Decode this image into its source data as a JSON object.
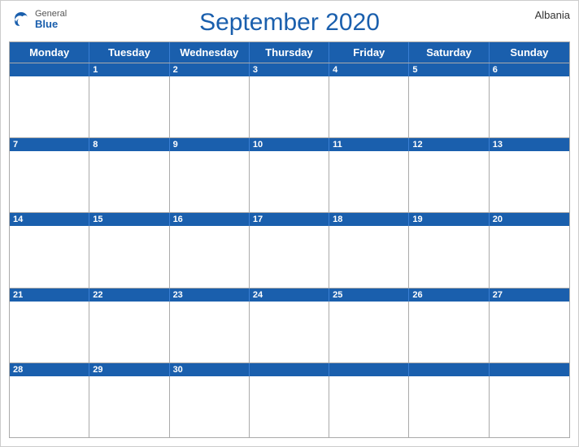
{
  "header": {
    "logo_general": "General",
    "logo_blue": "Blue",
    "title": "September 2020",
    "country": "Albania"
  },
  "days": [
    "Monday",
    "Tuesday",
    "Wednesday",
    "Thursday",
    "Friday",
    "Saturday",
    "Sunday"
  ],
  "weeks": [
    {
      "dates": [
        "",
        "1",
        "2",
        "3",
        "4",
        "5",
        "6"
      ]
    },
    {
      "dates": [
        "7",
        "8",
        "9",
        "10",
        "11",
        "12",
        "13"
      ]
    },
    {
      "dates": [
        "14",
        "15",
        "16",
        "17",
        "18",
        "19",
        "20"
      ]
    },
    {
      "dates": [
        "21",
        "22",
        "23",
        "24",
        "25",
        "26",
        "27"
      ]
    },
    {
      "dates": [
        "28",
        "29",
        "30",
        "",
        "",
        "",
        ""
      ]
    }
  ],
  "colors": {
    "primary": "#1a5fad",
    "header_text": "#ffffff",
    "border": "#aaaaaa"
  }
}
